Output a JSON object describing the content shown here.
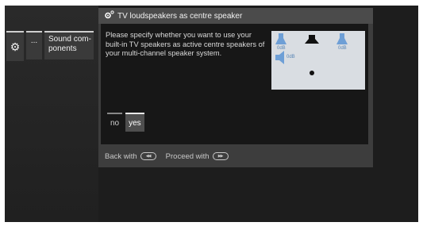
{
  "breadcrumb": {
    "items": [
      {
        "icon": "gear-icon",
        "label": ""
      },
      {
        "label": "..."
      },
      {
        "label": "Sound com-\nponents"
      }
    ]
  },
  "dialog": {
    "title": "TV loudspeakers as centre speaker",
    "title_icon": "settings-gear-icon",
    "message": "Please specify whether you want to use your built-in TV speakers as active centre speakers of your multi-channel speaker system.",
    "diagram": {
      "labels": {
        "front_left": "0dB",
        "front_right": "0dB",
        "side_left": "0dB"
      },
      "speaker_color": "#6e9fd6"
    },
    "options": [
      {
        "label": "no",
        "selected": false
      },
      {
        "label": "yes",
        "selected": true
      }
    ],
    "footer": {
      "back_label": "Back with",
      "back_button_icon": "rewind-button-icon",
      "proceed_label": "Proceed with",
      "proceed_button_icon": "fast-forward-button-icon"
    }
  }
}
